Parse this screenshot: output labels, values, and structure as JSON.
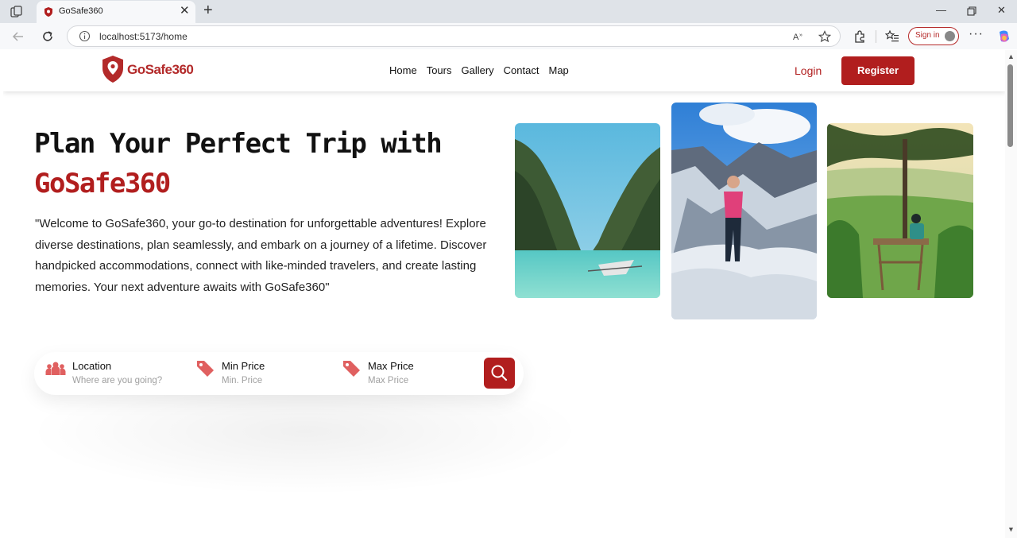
{
  "browser": {
    "tab_title": "GoSafe360",
    "url": "localhost:5173/home",
    "signin_label": "Sign in",
    "menu": "···"
  },
  "site": {
    "logo_text": "GoSafe360",
    "nav": [
      "Home",
      "Tours",
      "Gallery",
      "Contact",
      "Map"
    ],
    "login_label": "Login",
    "register_label": "Register"
  },
  "hero": {
    "title": "Plan Your Perfect Trip with",
    "brand": "GoSafe360",
    "description": "\"Welcome to GoSafe360, your go-to destination for unforgettable adventures! Explore diverse destinations, plan seamlessly, and embark on a journey of a lifetime. Discover handpicked accommodations, connect with like-minded travelers, and create lasting memories. Your next adventure awaits with GoSafe360\""
  },
  "search": {
    "location": {
      "label": "Location",
      "placeholder": "Where are you going?"
    },
    "min_price": {
      "label": "Min Price",
      "placeholder": "Min. Price"
    },
    "max_price": {
      "label": "Max Price",
      "placeholder": "Max Price"
    }
  },
  "colors": {
    "brand": "#b11e1e",
    "brand_light": "#e06060"
  },
  "icons": {
    "location": "people-group-icon",
    "price": "price-tag-icon",
    "search": "search-icon"
  }
}
